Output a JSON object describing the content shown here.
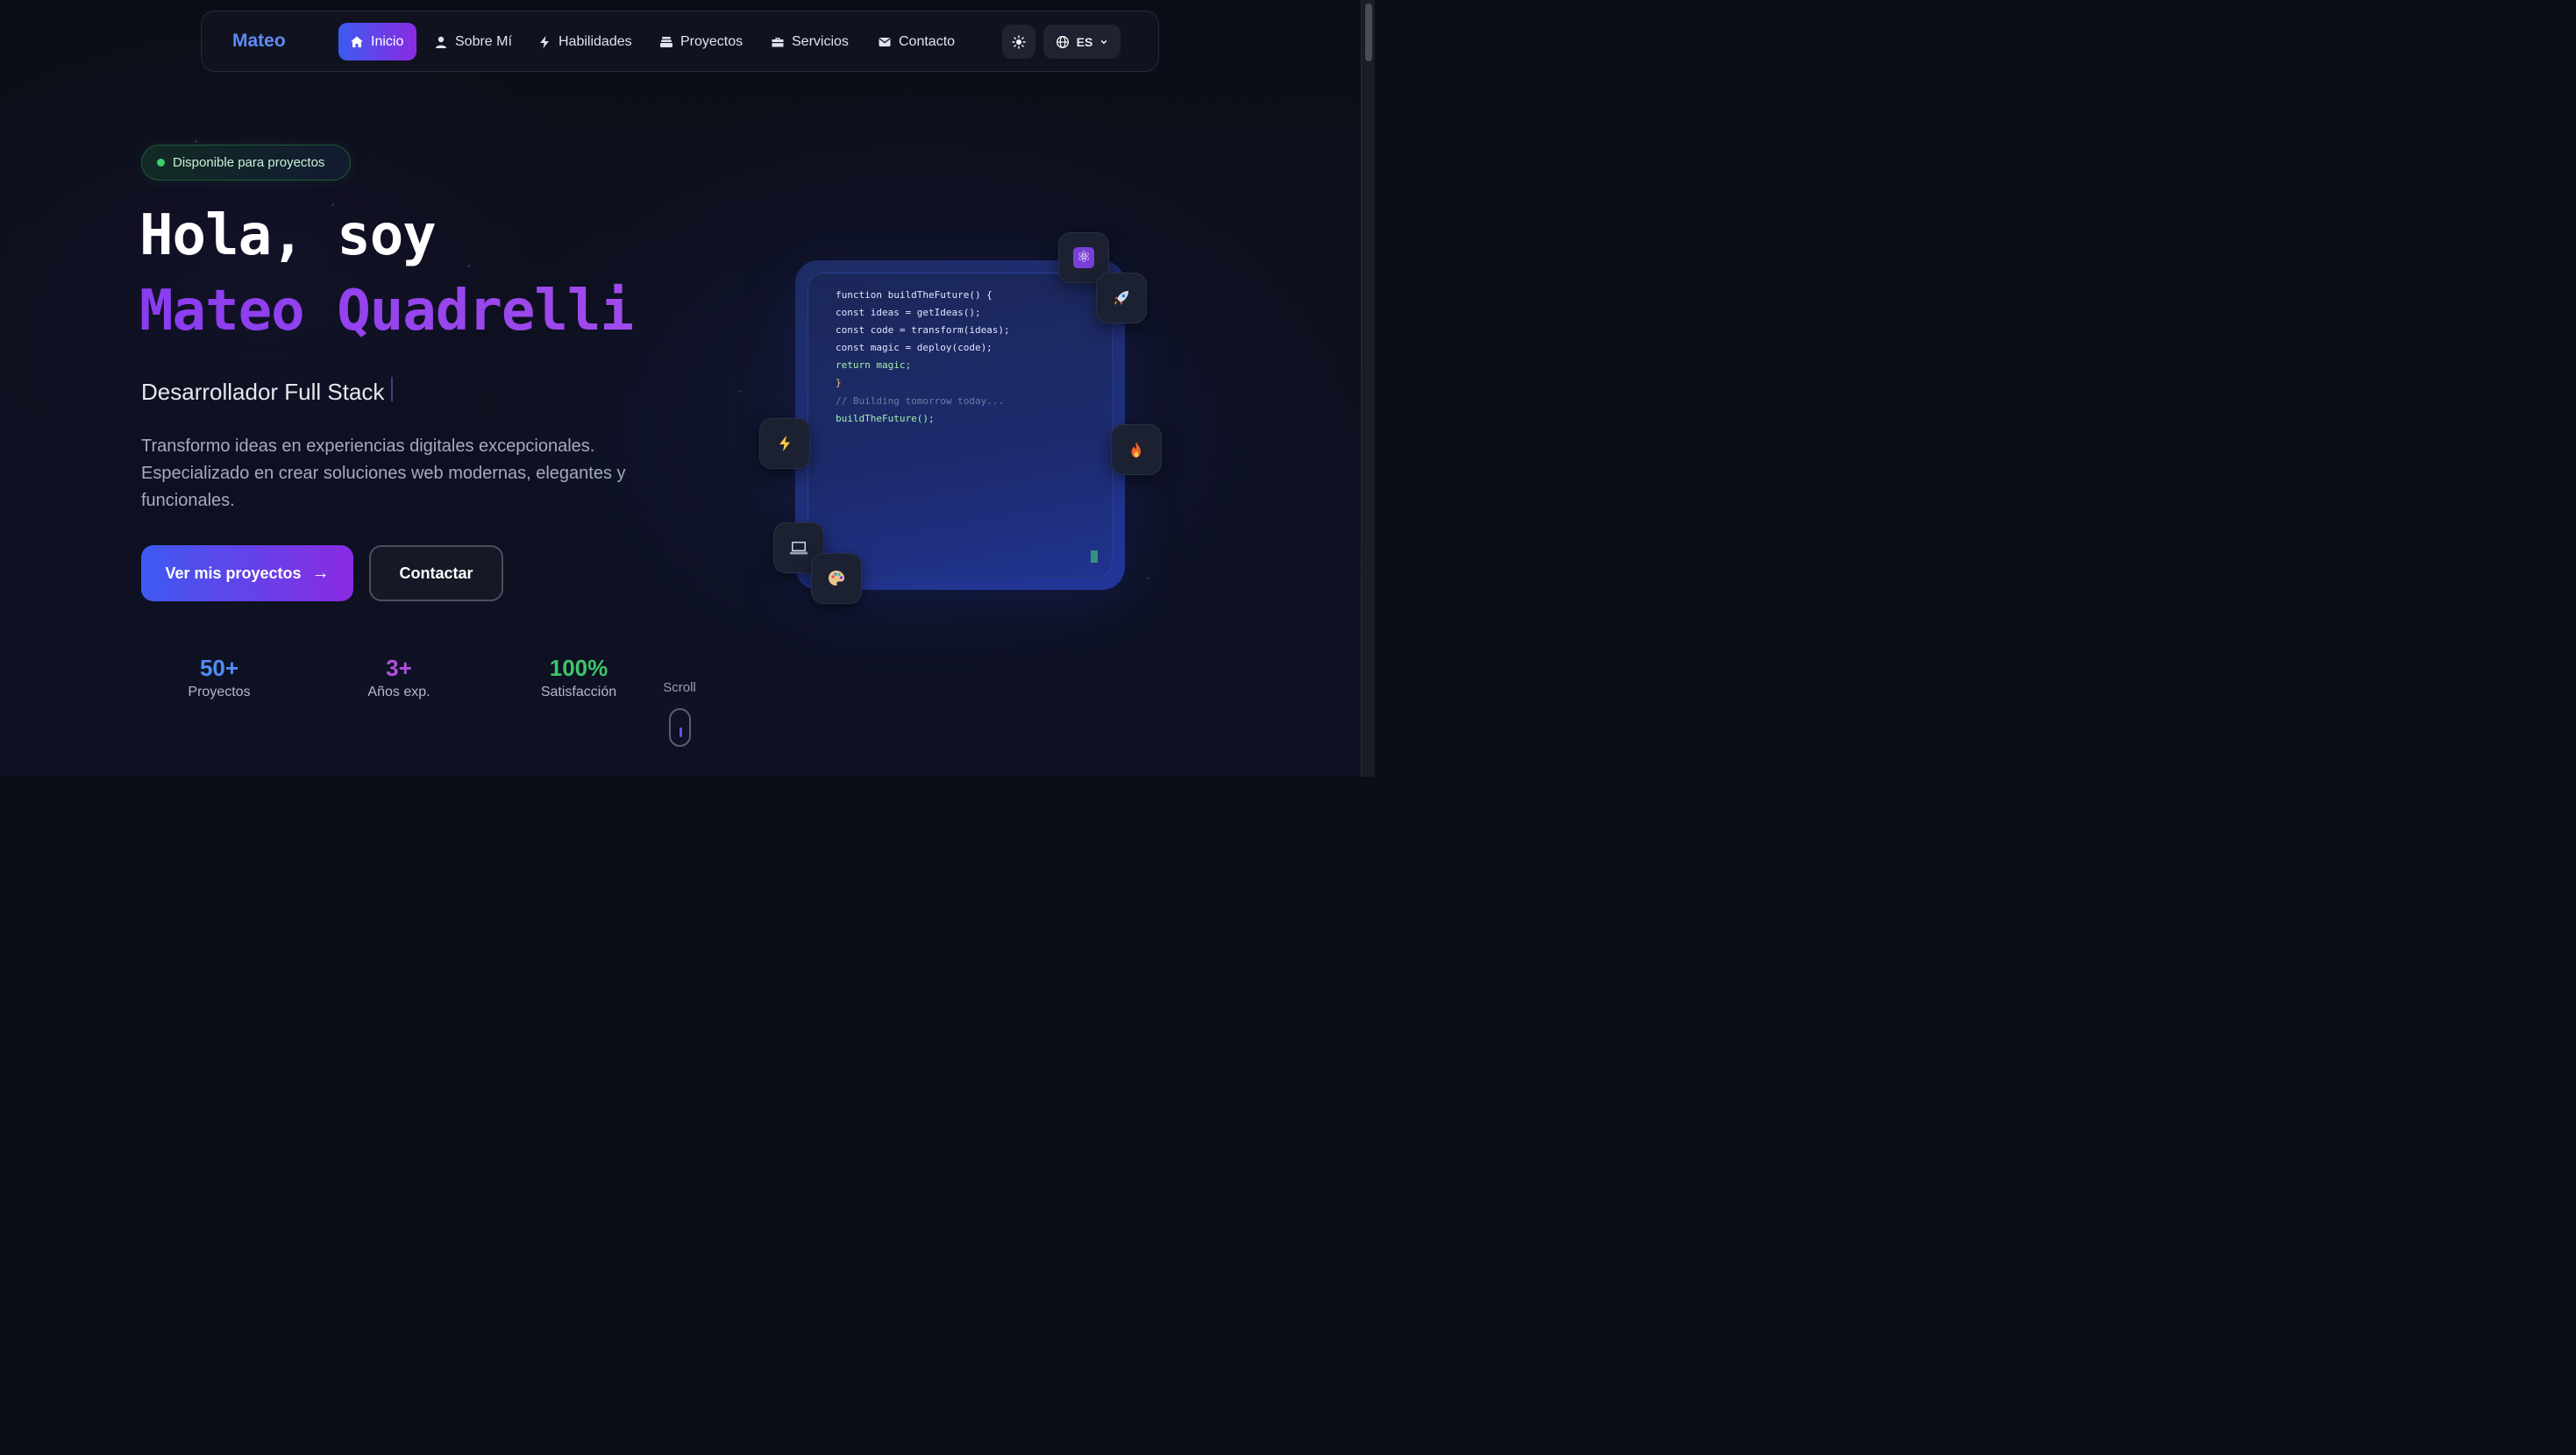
{
  "nav": {
    "brand": "Mateo",
    "items": [
      {
        "label": "Inicio",
        "icon": "home-icon",
        "active": true
      },
      {
        "label": "Sobre Mí",
        "icon": "user-icon",
        "active": false
      },
      {
        "label": "Habilidades",
        "icon": "bolt-icon",
        "active": false
      },
      {
        "label": "Proyectos",
        "icon": "layers-icon",
        "active": false
      },
      {
        "label": "Servicios",
        "icon": "briefcase-icon",
        "active": false
      },
      {
        "label": "Contacto",
        "icon": "envelope-icon",
        "active": false
      }
    ],
    "theme_toggle_icon": "sun-icon",
    "language": "ES",
    "language_icon": "globe-icon"
  },
  "hero": {
    "badge": "Disponible para proyectos",
    "greeting": "Hola, soy",
    "name": "Mateo Quadrelli",
    "role": "Desarrollador Full Stack",
    "description": "Transformo ideas en experiencias digitales excepcionales. Especializado en crear soluciones web modernas, elegantes y funcionales.",
    "primary_button": "Ver mis proyectos",
    "primary_button_arrow": "→",
    "secondary_button": "Contactar",
    "stats": [
      {
        "value": "50+",
        "label": "Proyectos",
        "color": "#4f8cf5"
      },
      {
        "value": "3+",
        "label": "Años exp.",
        "color": "#b04fe0"
      },
      {
        "value": "100%",
        "label": "Satisfacción",
        "color": "#3fc46a"
      }
    ],
    "scroll_label": "Scroll"
  },
  "code": {
    "lines": [
      {
        "text": "function buildTheFuture() {",
        "color": "#dfe6ff"
      },
      {
        "text": "const ideas = getIdeas();",
        "color": "#dfe6ff"
      },
      {
        "text": "const code = transform(ideas);",
        "color": "#dfe6ff"
      },
      {
        "text": "const magic = deploy(code);",
        "color": "#dfe6ff"
      },
      {
        "text": "return magic;",
        "color": "#a6f0b0"
      },
      {
        "text": "}",
        "color": "#f0c86a"
      },
      {
        "text": "// Building tomorrow today...",
        "color": "#6f7aa6"
      },
      {
        "text": "buildTheFuture();",
        "color": "#a6f0b0"
      }
    ]
  },
  "floating_icons": [
    {
      "name": "atom-icon",
      "glyph": "⚛"
    },
    {
      "name": "rocket-icon",
      "glyph": "🚀"
    },
    {
      "name": "lightning-icon",
      "glyph": "⚡"
    },
    {
      "name": "fire-icon",
      "glyph": "🔥"
    },
    {
      "name": "laptop-icon",
      "glyph": "💻"
    },
    {
      "name": "palette-icon",
      "glyph": "🎨"
    }
  ],
  "colors": {
    "accent_start": "#3d5af1",
    "accent_end": "#8a2be2",
    "brand": "#5b8cf5",
    "available": "#3ccf6e"
  }
}
